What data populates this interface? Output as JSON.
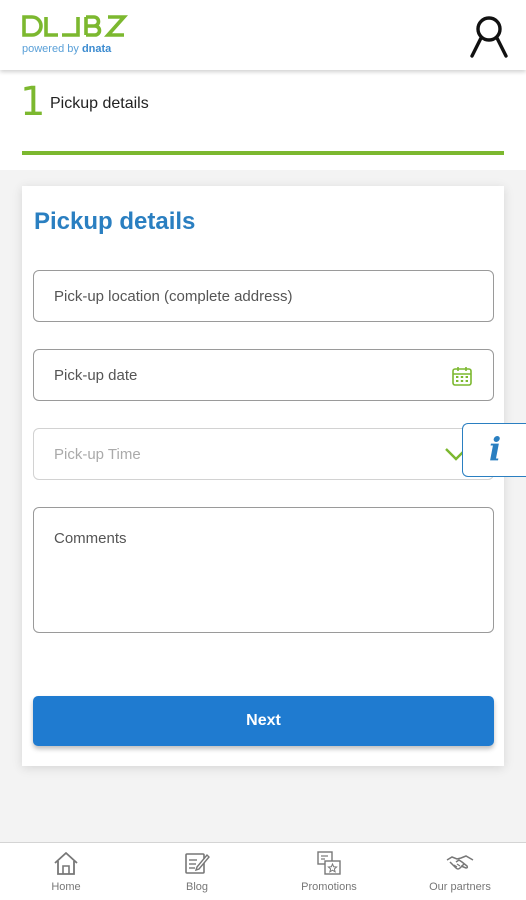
{
  "brand": {
    "name": "D⊔⊔BZ",
    "tagline_prefix": "powered by",
    "tagline_brand": "dnata",
    "primary_color": "#7cb82f",
    "accent_color": "#2a7fc1"
  },
  "header": {
    "profile_icon": "user-icon"
  },
  "step": {
    "number": "1",
    "label": "Pickup details"
  },
  "form": {
    "title": "Pickup details",
    "location_placeholder": "Pick-up location (complete address)",
    "date_placeholder": "Pick-up date",
    "time_placeholder": "Pick-up Time",
    "comments_placeholder": "Comments",
    "next_label": "Next"
  },
  "info_button": {
    "label": "i"
  },
  "bottom_nav": {
    "items": [
      {
        "label": "Home",
        "icon": "home-icon"
      },
      {
        "label": "Blog",
        "icon": "blog-icon"
      },
      {
        "label": "Promotions",
        "icon": "promotions-icon"
      },
      {
        "label": "Our partners",
        "icon": "handshake-icon"
      }
    ]
  }
}
